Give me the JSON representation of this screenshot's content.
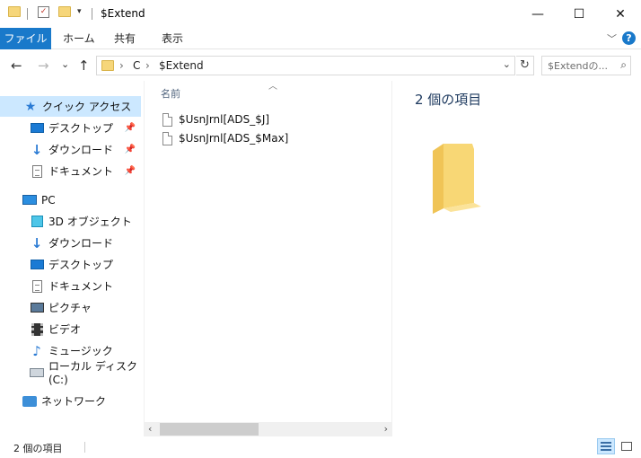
{
  "window": {
    "title": "$Extend",
    "minimize": "—",
    "maximize": "☐",
    "close": "✕"
  },
  "ribbon": {
    "tabs": [
      "ファイル",
      "ホーム",
      "共有",
      "表示"
    ],
    "help": "?"
  },
  "nav": {
    "back": "←",
    "forward": "→",
    "recent": "⌄",
    "up": "↑"
  },
  "address": {
    "crumbs": [
      "C",
      "$Extend"
    ],
    "sep": "›",
    "dropdown": "⌄",
    "refresh": "↻"
  },
  "search": {
    "placeholder": "$Extendの..."
  },
  "sidebar": {
    "items": [
      {
        "label": "クイック アクセス",
        "icon": "star-icon"
      },
      {
        "label": "デスクトップ",
        "icon": "desktop-icon",
        "pinned": true
      },
      {
        "label": "ダウンロード",
        "icon": "download-icon",
        "pinned": true
      },
      {
        "label": "ドキュメント",
        "icon": "document-icon",
        "pinned": true
      },
      {
        "label": "PC",
        "icon": "pc-icon"
      },
      {
        "label": "3D オブジェクト",
        "icon": "3d-objects-icon"
      },
      {
        "label": "ダウンロード",
        "icon": "download-icon"
      },
      {
        "label": "デスクトップ",
        "icon": "desktop-icon"
      },
      {
        "label": "ドキュメント",
        "icon": "document-icon"
      },
      {
        "label": "ピクチャ",
        "icon": "pictures-icon"
      },
      {
        "label": "ビデオ",
        "icon": "video-icon"
      },
      {
        "label": "ミュージック",
        "icon": "music-icon"
      },
      {
        "label": "ローカル ディスク (C:)",
        "icon": "drive-icon"
      },
      {
        "label": "ネットワーク",
        "icon": "network-icon"
      }
    ]
  },
  "content": {
    "column_header": "名前",
    "files": [
      {
        "name": "$UsnJrnl[ADS_$J]"
      },
      {
        "name": "$UsnJrnl[ADS_$Max]"
      }
    ]
  },
  "preview": {
    "title": "2 個の項目"
  },
  "status": {
    "item_count": "2 個の項目"
  },
  "colors": {
    "accent": "#1979ca",
    "selected": "#cce8ff",
    "folder": "#f6d67a"
  }
}
